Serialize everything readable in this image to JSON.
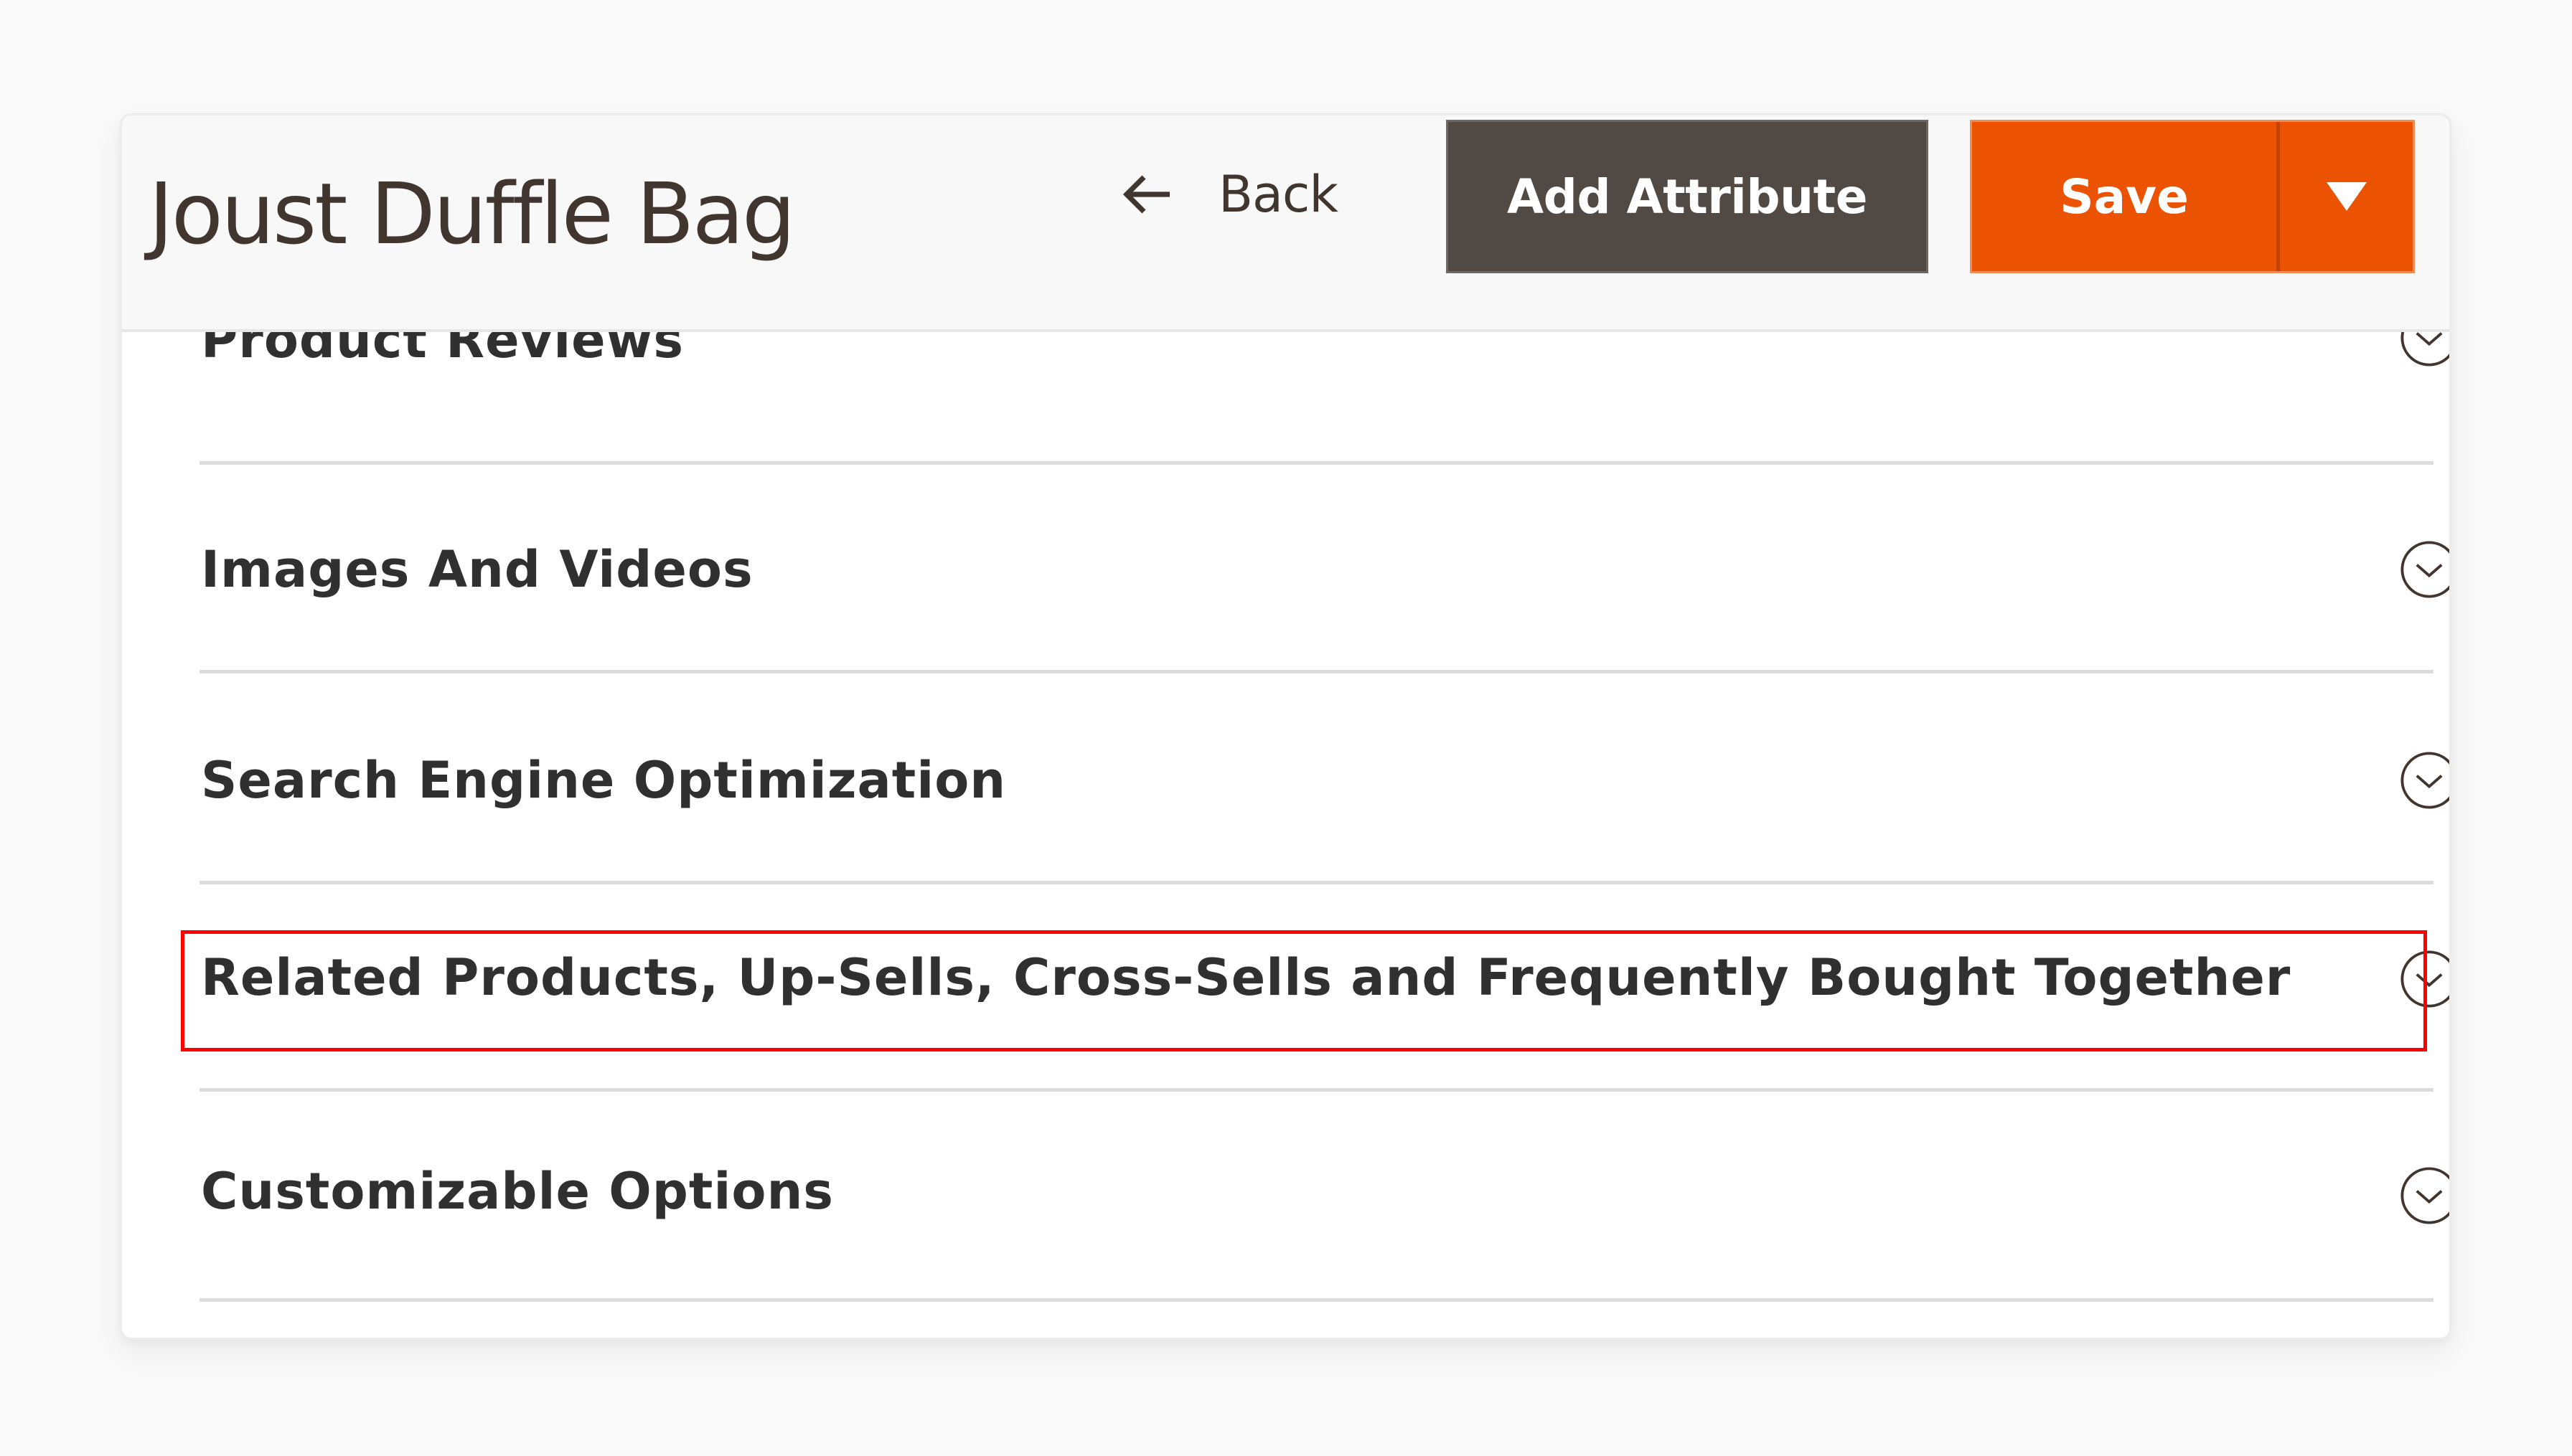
{
  "header": {
    "title": "Joust Duffle Bag",
    "back_label": "Back",
    "back_icon": "arrow-left-icon",
    "add_attribute_label": "Add Attribute",
    "save_label": "Save",
    "save_menu_icon": "caret-down-icon"
  },
  "colors": {
    "primary_action": "#eb5202",
    "secondary_action": "#514943",
    "text": "#41362f",
    "highlight": "#ff0000"
  },
  "sections": [
    {
      "title": "Product Reviews",
      "icon": "chevron-circle-down-icon",
      "state": "collapsed"
    },
    {
      "title": "Images And Videos",
      "icon": "chevron-circle-down-icon",
      "state": "collapsed"
    },
    {
      "title": "Search Engine Optimization",
      "icon": "chevron-circle-down-icon",
      "state": "collapsed"
    },
    {
      "title": "Related Products, Up-Sells, Cross-Sells and Frequently Bought Together",
      "icon": "chevron-circle-down-icon",
      "state": "collapsed",
      "highlighted": true
    },
    {
      "title": "Customizable Options",
      "icon": "chevron-circle-down-icon",
      "state": "collapsed"
    }
  ]
}
